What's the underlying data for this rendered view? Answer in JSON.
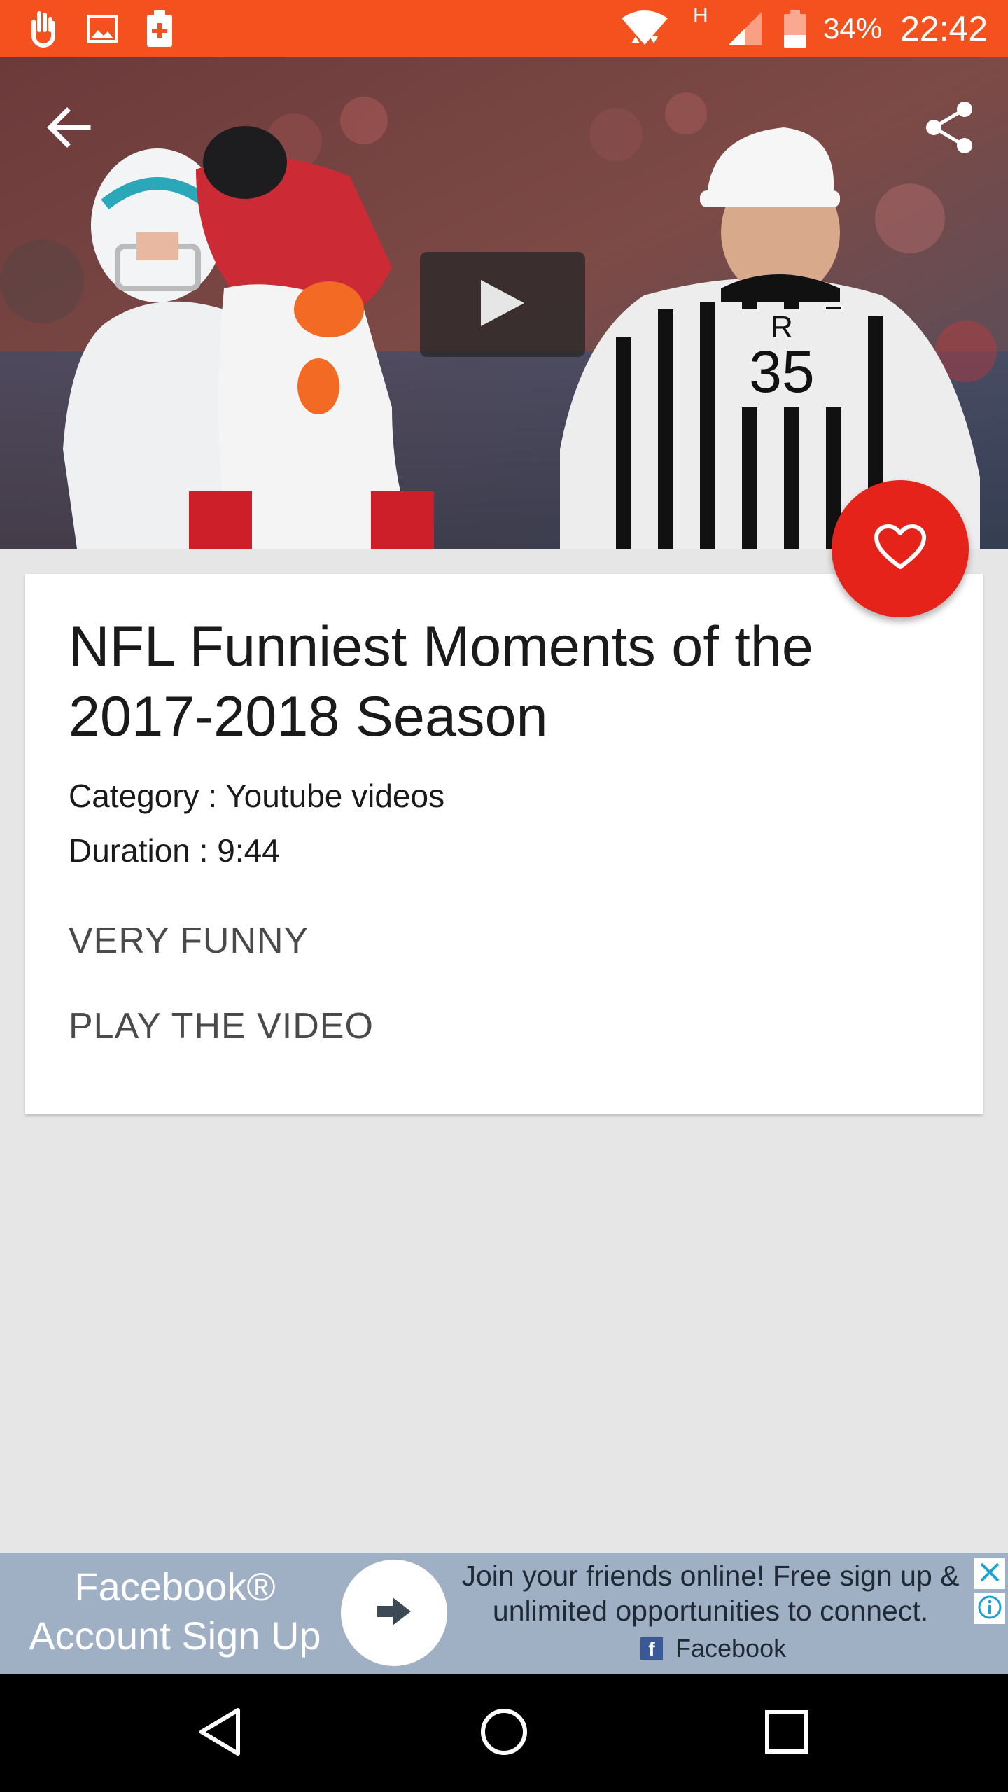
{
  "status_bar": {
    "battery_percent": "34%",
    "time": "22:42",
    "network_type": "H",
    "icons": [
      "hand-icon",
      "image-icon",
      "battery-plus-icon",
      "wifi-icon",
      "signal-icon",
      "battery-icon"
    ]
  },
  "hero": {
    "back_icon": "arrow-left-icon",
    "share_icon": "share-icon",
    "play_icon": "play-icon"
  },
  "video": {
    "title": "NFL Funniest Moments of the 2017-2018 Season",
    "category": "Category : Youtube videos",
    "duration": "Duration : 9:44",
    "tag": "VERY FUNNY",
    "play_label": "PLAY THE VIDEO",
    "favorite_icon": "heart-icon"
  },
  "ad": {
    "headline": "Facebook® Account Sign Up",
    "body": "Join your friends online! Free sign up & unlimited opportunities to connect.",
    "source": "Facebook",
    "arrow_icon": "arrow-right-icon",
    "close_icon": "close-icon",
    "info_icon": "info-icon"
  },
  "nav_bar": {
    "back_icon": "nav-back-icon",
    "home_icon": "nav-home-icon",
    "recents_icon": "nav-recents-icon"
  },
  "colors": {
    "status_bar": "#f4511e",
    "fab": "#e5231b",
    "page_bg": "#e6e6e6",
    "ad_bg": "#9fb0c4"
  }
}
